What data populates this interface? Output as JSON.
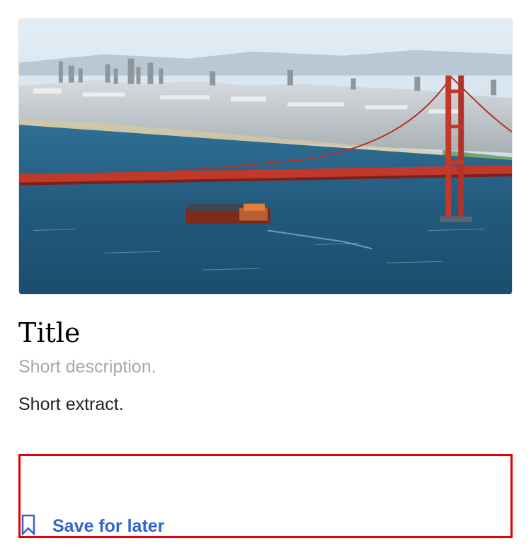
{
  "card": {
    "image_alt": "Golden Gate Bridge over San Francisco Bay with city skyline and cargo ship",
    "title": "Title",
    "description": "Short description.",
    "extract": "Short extract."
  },
  "actions": {
    "save_label": "Save for later",
    "save_icon": "bookmark-icon"
  },
  "colors": {
    "link_blue": "#3366cc",
    "description_gray": "#a2a9b1",
    "highlight_red": "#e60000",
    "bridge_red": "#c0392b"
  }
}
